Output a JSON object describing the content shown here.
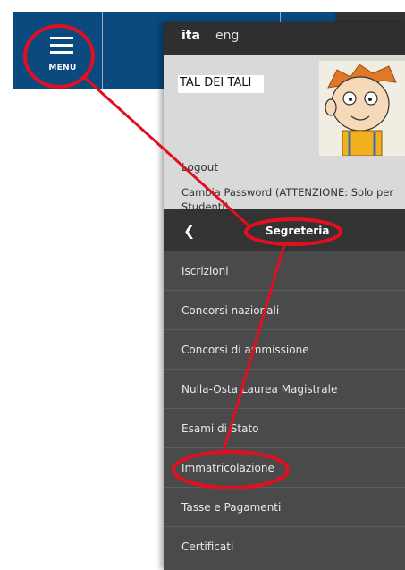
{
  "top_nav": {
    "menu_label": "MENU"
  },
  "side_panel": {
    "languages": [
      "ita",
      "eng"
    ],
    "user": {
      "name": "TAL DEI TALI",
      "logout_label": "Logout",
      "change_password_label": "Cambia Password (ATTENZIONE: Solo per Studenti)"
    },
    "section": {
      "title": "Segreteria"
    },
    "items": [
      {
        "label": "Iscrizioni"
      },
      {
        "label": "Concorsi nazionali"
      },
      {
        "label": "Concorsi di ammissione"
      },
      {
        "label": "Nulla-Osta Laurea Magistrale"
      },
      {
        "label": "Esami di Stato"
      },
      {
        "label": "Immatricolazione"
      },
      {
        "label": "Tasse e Pagamenti"
      },
      {
        "label": "Certificati"
      }
    ]
  },
  "colors": {
    "topbar": "#0b4a7e",
    "panel": "#4a4a4a",
    "annotation": "#e01020"
  }
}
